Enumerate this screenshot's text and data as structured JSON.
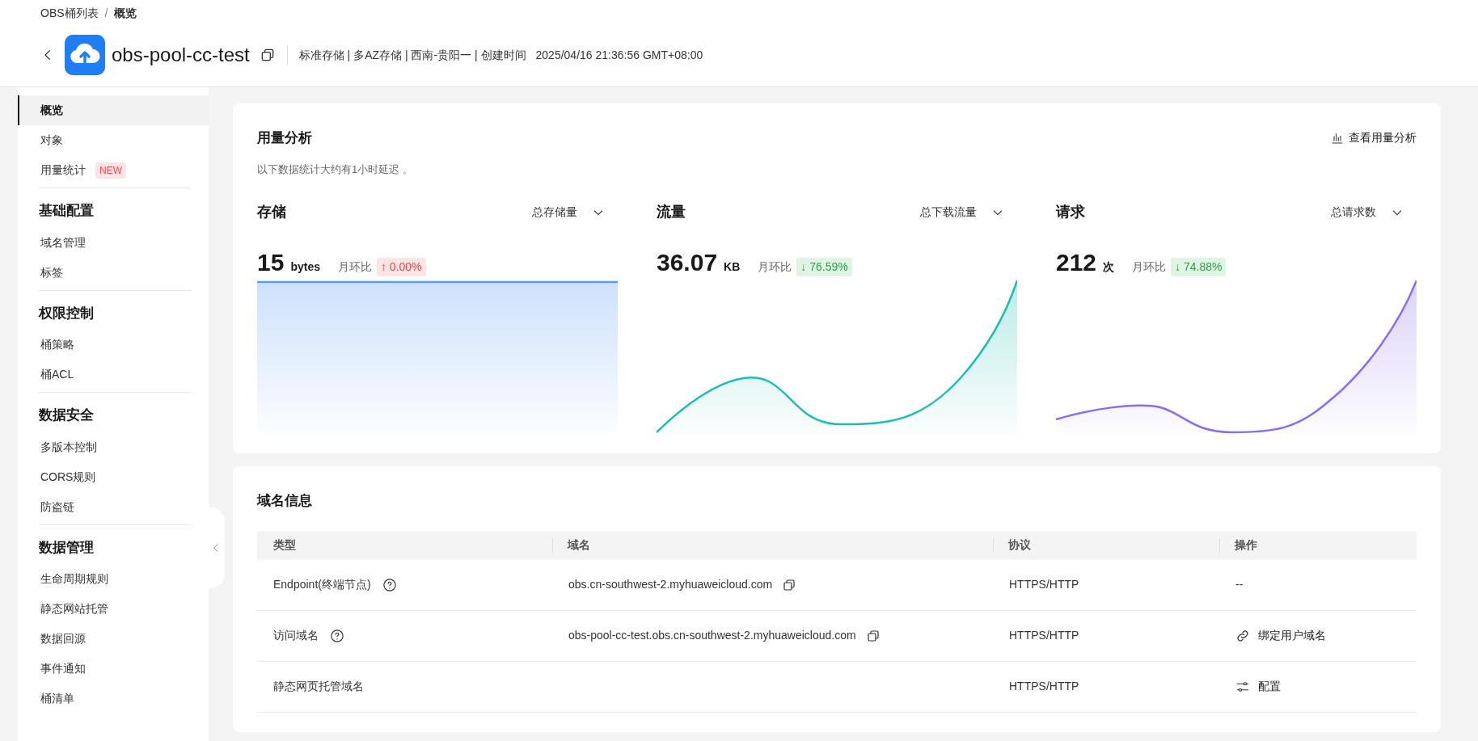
{
  "breadcrumb": {
    "separator": "/",
    "items": [
      {
        "label": "OBS桶列表",
        "current": false
      },
      {
        "label": "概览",
        "current": true
      }
    ]
  },
  "header": {
    "title": "obs-pool-cc-test",
    "meta": "标准存储 | 多AZ存储 | 西南-贵阳一 | 创建时间",
    "created": "2025/04/16 21:36:56 GMT+08:00"
  },
  "sidebar": {
    "sections": [
      {
        "items": [
          {
            "label": "概览",
            "selected": true
          },
          {
            "label": "对象",
            "selected": false
          },
          {
            "label": "用量统计",
            "selected": false,
            "badge": "NEW"
          }
        ]
      },
      {
        "title": "基础配置",
        "items": [
          {
            "label": "域名管理",
            "selected": false
          },
          {
            "label": "标签",
            "selected": false
          }
        ]
      },
      {
        "title": "权限控制",
        "items": [
          {
            "label": "桶策略",
            "selected": false
          },
          {
            "label": "桶ACL",
            "selected": false
          }
        ]
      },
      {
        "title": "数据安全",
        "items": [
          {
            "label": "多版本控制",
            "selected": false
          },
          {
            "label": "CORS规则",
            "selected": false
          },
          {
            "label": "防盗链",
            "selected": false
          }
        ]
      },
      {
        "title": "数据管理",
        "items": [
          {
            "label": "生命周期规则",
            "selected": false
          },
          {
            "label": "静态网站托管",
            "selected": false
          },
          {
            "label": "数据回源",
            "selected": false
          },
          {
            "label": "事件通知",
            "selected": false
          },
          {
            "label": "桶清单",
            "selected": false
          }
        ]
      }
    ]
  },
  "usage": {
    "title": "用量分析",
    "link": "查看用量分析",
    "note": "以下数据统计大约有1小时延迟 。",
    "metrics": [
      {
        "title": "存储",
        "dropdown": "总存储量",
        "value": "15",
        "unit": "bytes",
        "compare_label": "月环比",
        "change": "↑ 0.00%",
        "increase": true,
        "color": "#5b9cf5"
      },
      {
        "title": "流量",
        "dropdown": "总下载流量",
        "value": "36.07",
        "unit": "KB",
        "compare_label": "月环比",
        "change": "↓ 76.59%",
        "increase": false,
        "color": "#1dbdb0"
      },
      {
        "title": "请求",
        "dropdown": "总请求数",
        "value": "212",
        "unit": "次",
        "compare_label": "月环比",
        "change": "↓ 74.88%",
        "increase": false,
        "color": "#8a6cf0"
      }
    ]
  },
  "domain_info": {
    "title": "域名信息",
    "columns": [
      "类型",
      "域名",
      "协议",
      "操作"
    ],
    "rows": [
      {
        "type": "Endpoint(终端节点)",
        "help": true,
        "domain": "obs.cn-southwest-2.myhuaweicloud.com",
        "copyable": true,
        "protocol": "HTTPS/HTTP",
        "action": {
          "kind": "text",
          "label": "--"
        }
      },
      {
        "type": "访问域名",
        "help": true,
        "domain": "obs-pool-cc-test.obs.cn-southwest-2.myhuaweicloud.com",
        "copyable": true,
        "protocol": "HTTPS/HTTP",
        "action": {
          "kind": "link",
          "label": "绑定用户域名"
        }
      },
      {
        "type": "静态网页托管域名",
        "help": false,
        "protocol": "HTTPS/HTTP",
        "action": {
          "kind": "config",
          "label": "配置"
        }
      }
    ]
  }
}
